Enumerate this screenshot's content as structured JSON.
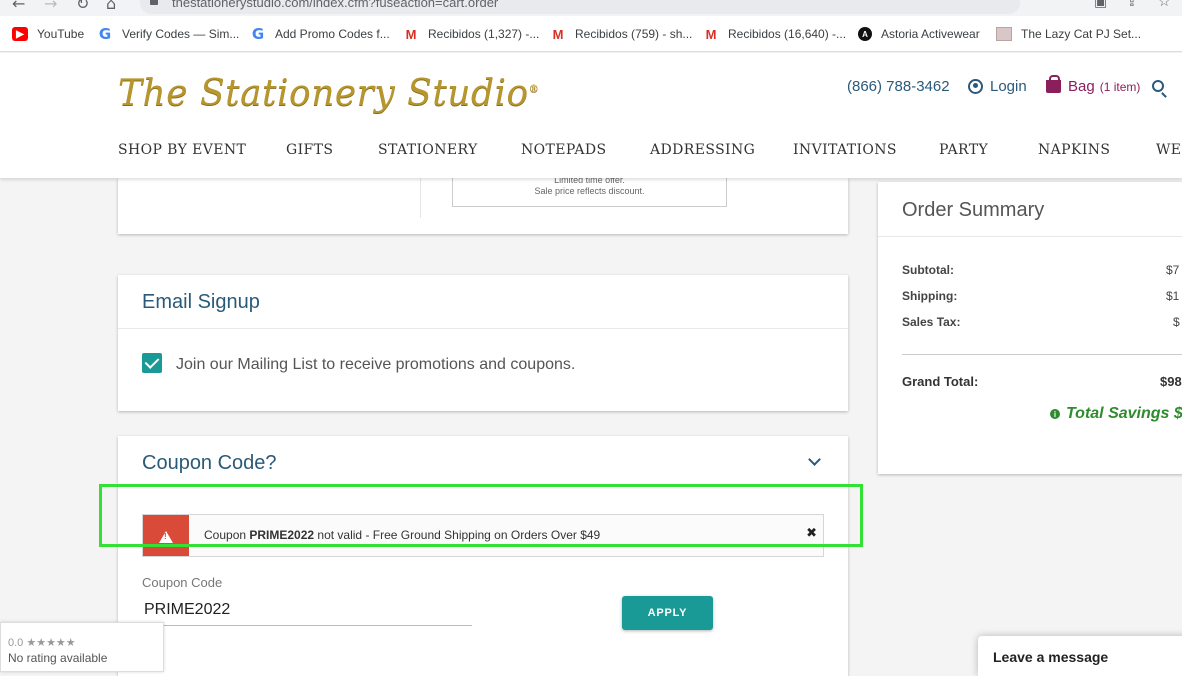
{
  "browser": {
    "url": "thestationerystudio.com/index.cfm?fuseaction=cart.order",
    "bookmarks": [
      {
        "label": "YouTube",
        "icon": "youtube-icon"
      },
      {
        "label": "Verify Codes — Sim...",
        "icon": "google-icon"
      },
      {
        "label": "Add Promo Codes f...",
        "icon": "google-icon"
      },
      {
        "label": "Recibidos (1,327) -...",
        "icon": "gmail-icon"
      },
      {
        "label": "Recibidos (759) - sh...",
        "icon": "gmail-icon"
      },
      {
        "label": "Recibidos (16,640) -...",
        "icon": "gmail-icon"
      },
      {
        "label": "Astoria Activewear",
        "icon": "astoria-icon"
      },
      {
        "label": "The Lazy Cat PJ Set...",
        "icon": "lazy-cat-icon"
      }
    ]
  },
  "header": {
    "logo": "The Stationery Studio",
    "phone": "(866) 788-3462",
    "login": "Login",
    "bag_label": "Bag",
    "bag_count": "(1 item)"
  },
  "nav": [
    "SHOP BY EVENT",
    "GIFTS",
    "STATIONERY",
    "NOTEPADS",
    "ADDRESSING",
    "INVITATIONS",
    "PARTY",
    "NAPKINS",
    "WE"
  ],
  "sale_note": {
    "line1": "Limited time offer.",
    "line2": "Sale price reflects discount."
  },
  "email_signup": {
    "title": "Email Signup",
    "checkbox_label": "Join our Mailing List to receive promotions and coupons.",
    "checked": true
  },
  "coupon": {
    "title": "Coupon Code?",
    "alert_prefix": "Coupon ",
    "alert_code": "PRIME2022",
    "alert_rest": " not valid - Free Ground Shipping on Orders Over $49",
    "input_label": "Coupon Code",
    "input_value": "PRIME2022",
    "apply_label": "APPLY"
  },
  "summary": {
    "title": "Order Summary",
    "rows": [
      {
        "label": "Subtotal:",
        "value": "$7"
      },
      {
        "label": "Shipping:",
        "value": "$1"
      },
      {
        "label": "Sales Tax:",
        "value": "$"
      }
    ],
    "grand_label": "Grand Total:",
    "grand_value": "$98",
    "savings": "Total Savings $"
  },
  "rating_widget": {
    "score": "0.0 ★★★★★",
    "text": "No rating available"
  },
  "chat": {
    "label": "Leave a message"
  },
  "colors": {
    "teal": "#1a9a96",
    "heading_blue": "#2a5a7a",
    "alert_red": "#d94a38",
    "highlight_green": "#33e034",
    "savings_green": "#2e8b2e",
    "logo_gold": "#b8962e",
    "bag_plum": "#8b1f5c"
  }
}
